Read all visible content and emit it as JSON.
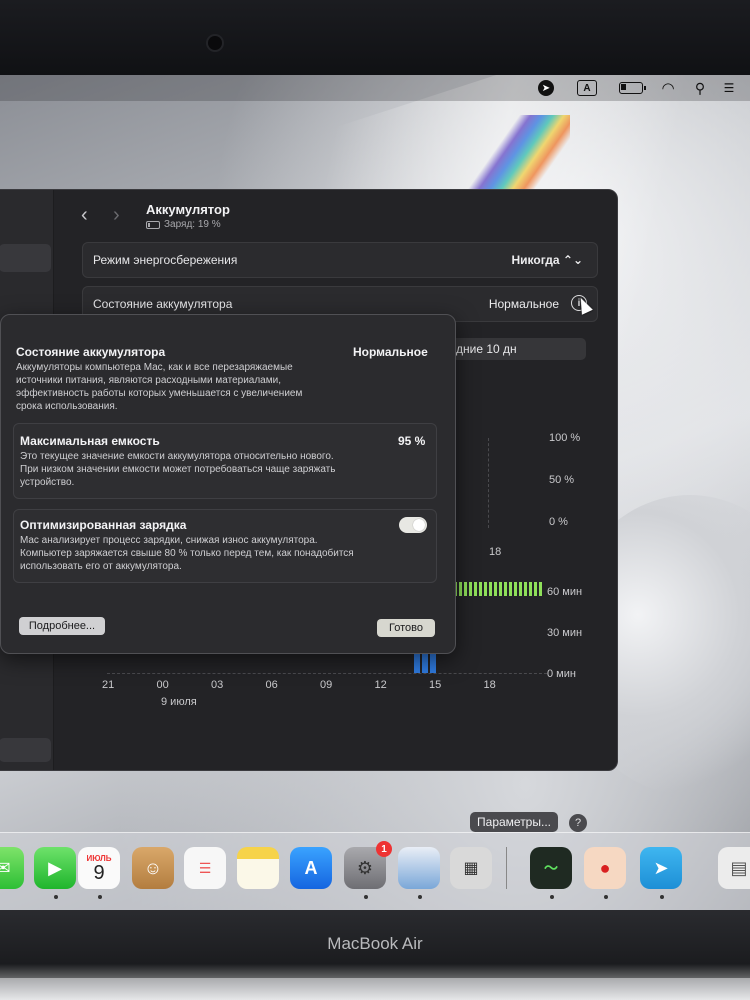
{
  "menubar": {
    "icons": [
      "location-icon",
      "input-source-icon",
      "battery-icon",
      "wifi-icon",
      "search-icon",
      "control-center-icon"
    ],
    "input_source": "A"
  },
  "window": {
    "title": "Аккумулятор",
    "subtitle": "Заряд: 19 %",
    "low_power_label": "Режим энергосбережения",
    "low_power_value": "Никогда ⌃⌄",
    "health_label": "Состояние аккумулятора",
    "health_value": "Нормальное",
    "period_tab": "дние 10 дн"
  },
  "chart_data": {
    "type": "bar",
    "title": "",
    "battery_level_axis": [
      "100 %",
      "50 %",
      "0 %"
    ],
    "usage_axis": [
      "60 мин",
      "30 мин",
      "0 мин"
    ],
    "x_ticks": [
      "21",
      "00",
      "03",
      "06",
      "09",
      "12",
      "15",
      "18"
    ],
    "x_ticks_upper_visible": [
      "18"
    ],
    "date_label": "9 июля",
    "series": [
      {
        "name": "",
        "values": [
          0,
          0,
          0,
          0,
          0,
          0,
          45,
          0
        ]
      }
    ],
    "ylim": [
      0,
      60
    ]
  },
  "buttons": {
    "params": "Параметры...",
    "help": "?"
  },
  "popover": {
    "health_title": "Состояние аккумулятора",
    "health_value": "Нормальное",
    "health_desc_1": "Аккумуляторы компьютера Mac, как и все перезаряжаемые",
    "health_desc_2": "источники питания, являются расходными материалами,",
    "health_desc_3": "эффективность работы которых уменьшается с увеличением",
    "health_desc_4": "срока использования.",
    "capacity_title": "Максимальная емкость",
    "capacity_value": "95 %",
    "capacity_desc_1": "Это текущее значение емкости аккумулятора относительно нового.",
    "capacity_desc_2": "При низком значении емкости может потребоваться чаще заряжать",
    "capacity_desc_3": "устройство.",
    "opt_title": "Оптимизированная зарядка",
    "opt_desc_1": "Mac анализирует процесс зарядки, снижая износ аккумулятора.",
    "opt_desc_2": "Компьютер заряжается свыше 80 % только перед тем, как понадобится",
    "opt_desc_3": "использовать его от аккумулятора.",
    "opt_enabled": true,
    "more_button": "Подробнее...",
    "done_button": "Готово"
  },
  "dock": {
    "calendar_month": "ИЮЛЬ",
    "calendar_day": "9",
    "settings_badge": "1",
    "items": [
      "messages-icon",
      "facetime-icon",
      "calendar-icon",
      "contacts-icon",
      "reminders-icon",
      "notes-icon",
      "app-store-icon",
      "system-settings-icon",
      "preview-icon",
      "calculator-icon",
      "activity-monitor-icon",
      "among-us-icon",
      "telegram-icon",
      "documents-icon"
    ]
  },
  "hardware": {
    "brand": "MacBook Air"
  },
  "colors": {
    "accent_green": "#8fe05a",
    "usage_blue": "#2f7be0",
    "badge_red": "#e33333"
  }
}
